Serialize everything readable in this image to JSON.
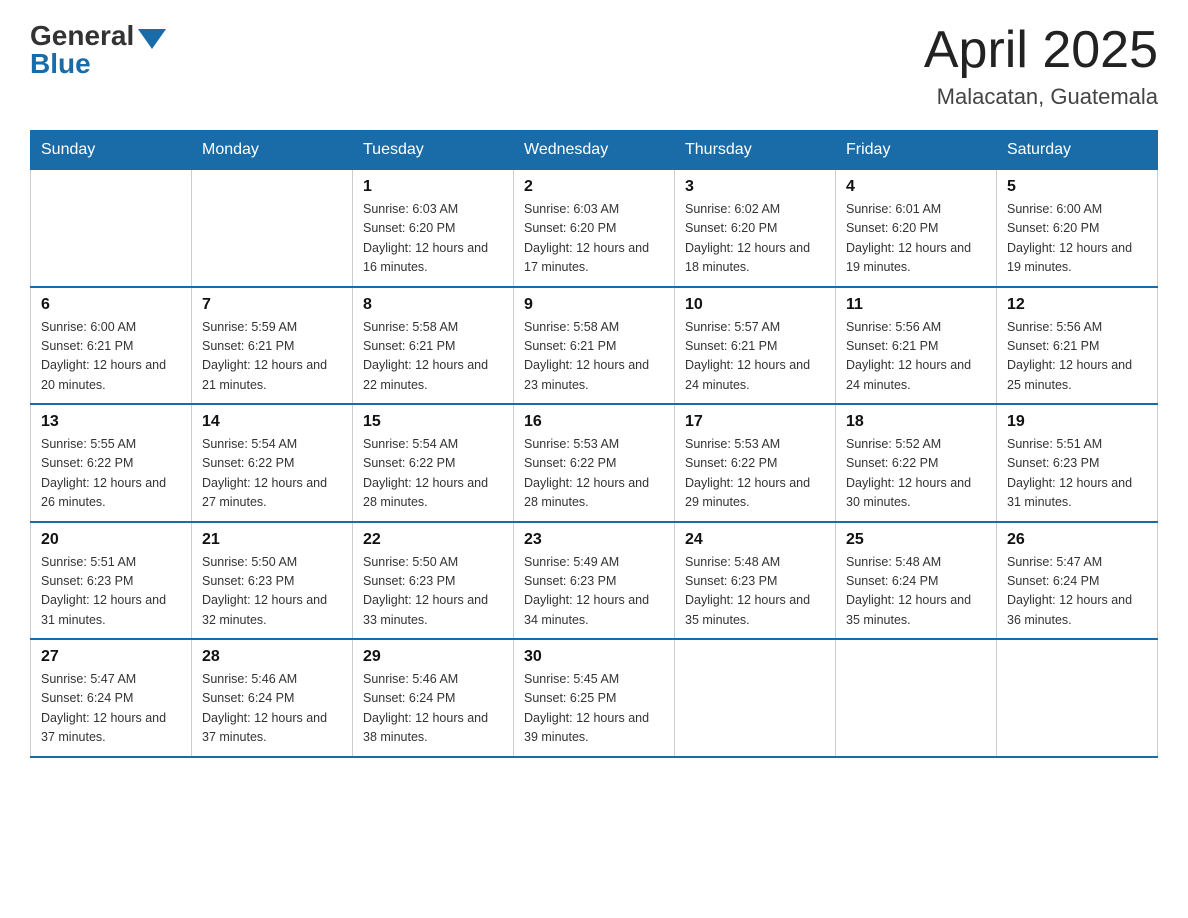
{
  "header": {
    "logo_general": "General",
    "logo_blue": "Blue",
    "title": "April 2025",
    "location": "Malacatan, Guatemala"
  },
  "weekdays": [
    "Sunday",
    "Monday",
    "Tuesday",
    "Wednesday",
    "Thursday",
    "Friday",
    "Saturday"
  ],
  "weeks": [
    [
      {
        "day": "",
        "sunrise": "",
        "sunset": "",
        "daylight": ""
      },
      {
        "day": "",
        "sunrise": "",
        "sunset": "",
        "daylight": ""
      },
      {
        "day": "1",
        "sunrise": "Sunrise: 6:03 AM",
        "sunset": "Sunset: 6:20 PM",
        "daylight": "Daylight: 12 hours and 16 minutes."
      },
      {
        "day": "2",
        "sunrise": "Sunrise: 6:03 AM",
        "sunset": "Sunset: 6:20 PM",
        "daylight": "Daylight: 12 hours and 17 minutes."
      },
      {
        "day": "3",
        "sunrise": "Sunrise: 6:02 AM",
        "sunset": "Sunset: 6:20 PM",
        "daylight": "Daylight: 12 hours and 18 minutes."
      },
      {
        "day": "4",
        "sunrise": "Sunrise: 6:01 AM",
        "sunset": "Sunset: 6:20 PM",
        "daylight": "Daylight: 12 hours and 19 minutes."
      },
      {
        "day": "5",
        "sunrise": "Sunrise: 6:00 AM",
        "sunset": "Sunset: 6:20 PM",
        "daylight": "Daylight: 12 hours and 19 minutes."
      }
    ],
    [
      {
        "day": "6",
        "sunrise": "Sunrise: 6:00 AM",
        "sunset": "Sunset: 6:21 PM",
        "daylight": "Daylight: 12 hours and 20 minutes."
      },
      {
        "day": "7",
        "sunrise": "Sunrise: 5:59 AM",
        "sunset": "Sunset: 6:21 PM",
        "daylight": "Daylight: 12 hours and 21 minutes."
      },
      {
        "day": "8",
        "sunrise": "Sunrise: 5:58 AM",
        "sunset": "Sunset: 6:21 PM",
        "daylight": "Daylight: 12 hours and 22 minutes."
      },
      {
        "day": "9",
        "sunrise": "Sunrise: 5:58 AM",
        "sunset": "Sunset: 6:21 PM",
        "daylight": "Daylight: 12 hours and 23 minutes."
      },
      {
        "day": "10",
        "sunrise": "Sunrise: 5:57 AM",
        "sunset": "Sunset: 6:21 PM",
        "daylight": "Daylight: 12 hours and 24 minutes."
      },
      {
        "day": "11",
        "sunrise": "Sunrise: 5:56 AM",
        "sunset": "Sunset: 6:21 PM",
        "daylight": "Daylight: 12 hours and 24 minutes."
      },
      {
        "day": "12",
        "sunrise": "Sunrise: 5:56 AM",
        "sunset": "Sunset: 6:21 PM",
        "daylight": "Daylight: 12 hours and 25 minutes."
      }
    ],
    [
      {
        "day": "13",
        "sunrise": "Sunrise: 5:55 AM",
        "sunset": "Sunset: 6:22 PM",
        "daylight": "Daylight: 12 hours and 26 minutes."
      },
      {
        "day": "14",
        "sunrise": "Sunrise: 5:54 AM",
        "sunset": "Sunset: 6:22 PM",
        "daylight": "Daylight: 12 hours and 27 minutes."
      },
      {
        "day": "15",
        "sunrise": "Sunrise: 5:54 AM",
        "sunset": "Sunset: 6:22 PM",
        "daylight": "Daylight: 12 hours and 28 minutes."
      },
      {
        "day": "16",
        "sunrise": "Sunrise: 5:53 AM",
        "sunset": "Sunset: 6:22 PM",
        "daylight": "Daylight: 12 hours and 28 minutes."
      },
      {
        "day": "17",
        "sunrise": "Sunrise: 5:53 AM",
        "sunset": "Sunset: 6:22 PM",
        "daylight": "Daylight: 12 hours and 29 minutes."
      },
      {
        "day": "18",
        "sunrise": "Sunrise: 5:52 AM",
        "sunset": "Sunset: 6:22 PM",
        "daylight": "Daylight: 12 hours and 30 minutes."
      },
      {
        "day": "19",
        "sunrise": "Sunrise: 5:51 AM",
        "sunset": "Sunset: 6:23 PM",
        "daylight": "Daylight: 12 hours and 31 minutes."
      }
    ],
    [
      {
        "day": "20",
        "sunrise": "Sunrise: 5:51 AM",
        "sunset": "Sunset: 6:23 PM",
        "daylight": "Daylight: 12 hours and 31 minutes."
      },
      {
        "day": "21",
        "sunrise": "Sunrise: 5:50 AM",
        "sunset": "Sunset: 6:23 PM",
        "daylight": "Daylight: 12 hours and 32 minutes."
      },
      {
        "day": "22",
        "sunrise": "Sunrise: 5:50 AM",
        "sunset": "Sunset: 6:23 PM",
        "daylight": "Daylight: 12 hours and 33 minutes."
      },
      {
        "day": "23",
        "sunrise": "Sunrise: 5:49 AM",
        "sunset": "Sunset: 6:23 PM",
        "daylight": "Daylight: 12 hours and 34 minutes."
      },
      {
        "day": "24",
        "sunrise": "Sunrise: 5:48 AM",
        "sunset": "Sunset: 6:23 PM",
        "daylight": "Daylight: 12 hours and 35 minutes."
      },
      {
        "day": "25",
        "sunrise": "Sunrise: 5:48 AM",
        "sunset": "Sunset: 6:24 PM",
        "daylight": "Daylight: 12 hours and 35 minutes."
      },
      {
        "day": "26",
        "sunrise": "Sunrise: 5:47 AM",
        "sunset": "Sunset: 6:24 PM",
        "daylight": "Daylight: 12 hours and 36 minutes."
      }
    ],
    [
      {
        "day": "27",
        "sunrise": "Sunrise: 5:47 AM",
        "sunset": "Sunset: 6:24 PM",
        "daylight": "Daylight: 12 hours and 37 minutes."
      },
      {
        "day": "28",
        "sunrise": "Sunrise: 5:46 AM",
        "sunset": "Sunset: 6:24 PM",
        "daylight": "Daylight: 12 hours and 37 minutes."
      },
      {
        "day": "29",
        "sunrise": "Sunrise: 5:46 AM",
        "sunset": "Sunset: 6:24 PM",
        "daylight": "Daylight: 12 hours and 38 minutes."
      },
      {
        "day": "30",
        "sunrise": "Sunrise: 5:45 AM",
        "sunset": "Sunset: 6:25 PM",
        "daylight": "Daylight: 12 hours and 39 minutes."
      },
      {
        "day": "",
        "sunrise": "",
        "sunset": "",
        "daylight": ""
      },
      {
        "day": "",
        "sunrise": "",
        "sunset": "",
        "daylight": ""
      },
      {
        "day": "",
        "sunrise": "",
        "sunset": "",
        "daylight": ""
      }
    ]
  ]
}
